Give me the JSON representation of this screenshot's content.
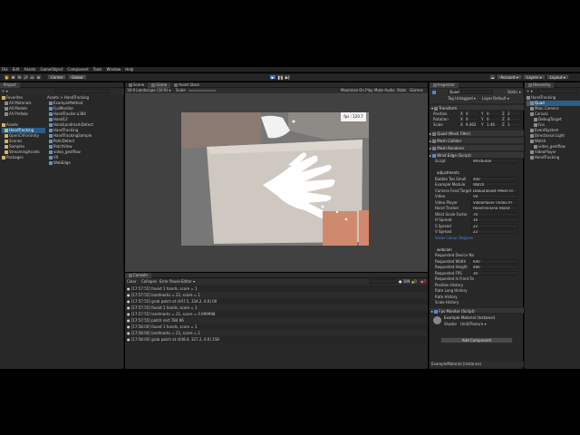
{
  "menu": [
    "File",
    "Edit",
    "Assets",
    "GameObject",
    "Component",
    "Tools",
    "Window",
    "Help"
  ],
  "toolbar": {
    "center_label": "Center",
    "global_label": "Global",
    "account": "Account",
    "layers": "Layers",
    "layout": "Layout"
  },
  "project": {
    "tab": "Project",
    "tree": [
      {
        "label": "Favorites",
        "indent": 0,
        "kind": "folder"
      },
      {
        "label": "All Materials",
        "indent": 1,
        "kind": "search"
      },
      {
        "label": "All Models",
        "indent": 1,
        "kind": "search"
      },
      {
        "label": "All Prefabs",
        "indent": 1,
        "kind": "search"
      },
      {
        "label": "",
        "indent": 0,
        "kind": "blank"
      },
      {
        "label": "Assets",
        "indent": 0,
        "kind": "folder"
      },
      {
        "label": "HandTracking",
        "indent": 1,
        "kind": "folder",
        "selected": true
      },
      {
        "label": "OpenCVForUnity",
        "indent": 1,
        "kind": "folder"
      },
      {
        "label": "Scenes",
        "indent": 1,
        "kind": "folder"
      },
      {
        "label": "Samples",
        "indent": 1,
        "kind": "folder"
      },
      {
        "label": "StreamingAssets",
        "indent": 1,
        "kind": "folder"
      },
      {
        "label": "Packages",
        "indent": 0,
        "kind": "folder"
      }
    ],
    "breadcrumb": "Assets > HandTracking",
    "files": [
      "ExampleMethod",
      "FpsMonitor",
      "HandTracker.a384",
      "Hand12",
      "HandLandmarkDetect",
      "HandTracking",
      "HandTrackingSample",
      "PalmDetect",
      "PatchView",
      "video_gestflow",
      "VII",
      "WebEdge"
    ]
  },
  "scene_tabs": [
    "Scene",
    "Game",
    "Asset Store"
  ],
  "game_bar": {
    "display": "Display 1",
    "aspect": "16:9 Landscape (16:9)",
    "scale_label": "Scale",
    "options": [
      "Maximize On Play",
      "Mute Audio",
      "Stats",
      "Gizmos"
    ]
  },
  "fps": {
    "label": "fps",
    "value": "120.7"
  },
  "console": {
    "tab": "Console",
    "toolbar": [
      "Clear",
      "Collapse",
      "Error Pause",
      "Editor"
    ],
    "counts": [
      "189",
      "0",
      "0"
    ],
    "logs": [
      "[17:57:55] found 1 hands, score = 1",
      "[17:57:55] landmarks = 21, score = 1",
      "[17:57:55] grab patch at (447.5, 334.2, 0.0) 00",
      "[17:57:55] found 1 hands, score = 1",
      "[17:57:55] landmarks = 21, score = 0.999998",
      "[17:57:55] patch rect 784 96",
      "[17:58:00] found 1 hands, score = 1",
      "[17:58:00] landmarks = 21, score = 1",
      "[17:58:00] grab patch at (448.4, 327.2, 0.0) 158"
    ]
  },
  "inspector": {
    "tab": "Inspector",
    "object_name": "Quad",
    "tag_label": "Untagged",
    "layer_label": "Layer",
    "layer_value": "Default",
    "transform": {
      "title": "Transform",
      "rows": [
        {
          "label": "Position",
          "x": "0",
          "y": "0",
          "z": "2"
        },
        {
          "label": "Rotation",
          "x": "0",
          "y": "0",
          "z": "0"
        },
        {
          "label": "Scale",
          "x": "6.462",
          "y": "1.46",
          "z": "1"
        }
      ]
    },
    "components": [
      "Quad (Mesh Filter)",
      "Mesh Collider",
      "Mesh Renderer",
      "Wrist Edge (Script)"
    ],
    "script_rows": [
      {
        "label": "Script",
        "value": "WristEdge"
      },
      {
        "label": "",
        "value": ""
      },
      {
        "label": "adjustments",
        "value": "",
        "header": true
      },
      {
        "label": "Bubble Too Small",
        "value": "400"
      },
      {
        "label": "Example Module",
        "value": "Watch"
      },
      {
        "label": "Camera Feed Target",
        "value": "DebugTarget (Mesh R)"
      },
      {
        "label": "Video",
        "value": "VII"
      },
      {
        "label": "Video Player",
        "value": "VideoPlayer (Video P)"
      },
      {
        "label": "Hand Tracker",
        "value": "HandTracking (Hand"
      },
      {
        "label": "Wrist Scale Factor",
        "value": "70"
      },
      {
        "label": "H Spread",
        "value": "16"
      },
      {
        "label": "S Spread",
        "value": "22"
      },
      {
        "label": "V Spread",
        "value": "22"
      },
      {
        "label": "Show Colour Regions",
        "value": "",
        "link": true
      },
      {
        "label": "",
        "value": ""
      },
      {
        "label": "webcam",
        "value": "",
        "header": true
      },
      {
        "label": "Requested Device Na",
        "value": ""
      },
      {
        "label": "Requested Width",
        "value": "640"
      },
      {
        "label": "Requested Height",
        "value": "480"
      },
      {
        "label": "Requested FPS",
        "value": "30"
      },
      {
        "label": "Requested Is Front Fa",
        "value": ""
      },
      {
        "label": "Position History",
        "value": ""
      },
      {
        "label": "Rate Long History",
        "value": ""
      },
      {
        "label": "Rate History",
        "value": ""
      },
      {
        "label": "Scale History",
        "value": ""
      }
    ],
    "fps_monitor": "Fps Monitor (Script)",
    "material": "Example Material (Instance)",
    "shader_label": "Shader",
    "shader_value": "Unlit/Texture",
    "add_component": "Add Component",
    "footer": "ExampleMaterial (Instance)"
  },
  "hierarchy": {
    "tab": "Hierarchy",
    "items": [
      {
        "label": "HandTracking",
        "indent": 0
      },
      {
        "label": "Quad",
        "indent": 1
      },
      {
        "label": "Main Camera",
        "indent": 1
      },
      {
        "label": "Canvas",
        "indent": 1
      },
      {
        "label": "DebugTarget",
        "indent": 2
      },
      {
        "label": "Fps",
        "indent": 2
      },
      {
        "label": "EventSystem",
        "indent": 1
      },
      {
        "label": "Directional Light",
        "indent": 1
      },
      {
        "label": "Watch",
        "indent": 1
      },
      {
        "label": "video_gestflow",
        "indent": 2
      },
      {
        "label": "VideoPlayer",
        "indent": 1
      },
      {
        "label": "HandTracking",
        "indent": 1
      }
    ]
  }
}
